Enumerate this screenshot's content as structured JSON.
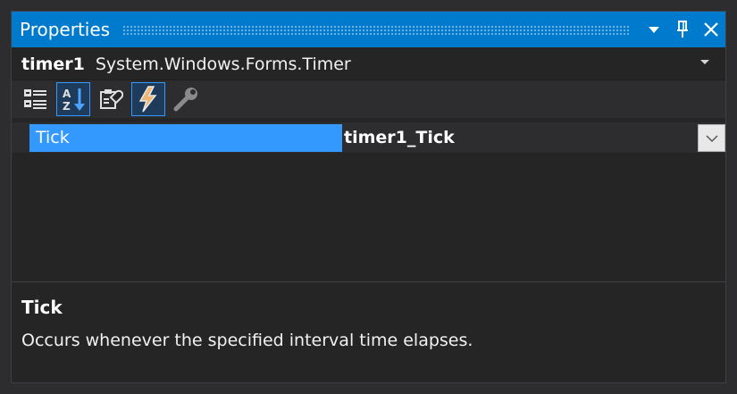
{
  "window": {
    "title": "Properties",
    "buttons": [
      {
        "icon": "dropdown-arrow-icon",
        "glyph": "▼"
      },
      {
        "icon": "pin-icon",
        "glyph": "📌"
      },
      {
        "icon": "close-icon",
        "glyph": "✕"
      }
    ]
  },
  "object_selector": {
    "name": "timer1",
    "type": "System.Windows.Forms.Timer"
  },
  "toolbar": {
    "tools": [
      {
        "icon": "categorized-icon",
        "active": false
      },
      {
        "icon": "alphabetical-icon",
        "active": true
      },
      {
        "icon": "properties-icon",
        "active": false
      },
      {
        "icon": "events-icon",
        "active": true
      },
      {
        "icon": "property-pages-icon",
        "active": false
      }
    ]
  },
  "grid": {
    "rows": [
      {
        "name": "Tick",
        "value": "timer1_Tick"
      }
    ]
  },
  "description": {
    "title": "Tick",
    "text": "Occurs whenever the specified interval time elapses."
  },
  "colors": {
    "accent": "#007acc",
    "selection": "#3399ff",
    "background": "#252526"
  }
}
